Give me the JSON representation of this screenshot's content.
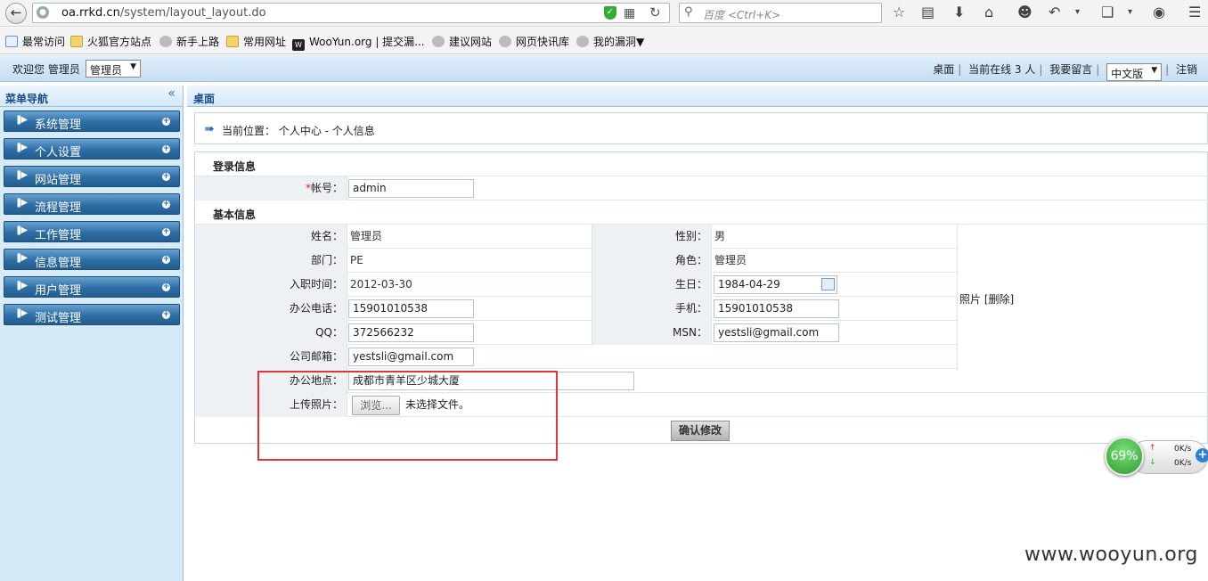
{
  "browser": {
    "url_domain": "oa.rrkd.cn",
    "url_path": "/system/layout_layout.do",
    "search_placeholder": "百度 <Ctrl+K>",
    "icons": [
      "back-icon",
      "globe-icon",
      "shield-icon",
      "qr-icon",
      "reload-icon",
      "search-icon",
      "star-icon",
      "reading-list-icon",
      "download-icon",
      "home-icon",
      "chat-icon",
      "undo-icon",
      "crop-icon",
      "comment-icon",
      "menu-icon"
    ]
  },
  "bookmarks": [
    {
      "label": "最常访问",
      "icon": "search-page-icon"
    },
    {
      "label": "火狐官方站点",
      "icon": "folder-icon"
    },
    {
      "label": "新手上路",
      "icon": "globe-icon"
    },
    {
      "label": "常用网址",
      "icon": "folder-icon"
    },
    {
      "label": "WooYun.org | 提交漏...",
      "icon": "wooyun-icon"
    },
    {
      "label": "建议网站",
      "icon": "globe-icon"
    },
    {
      "label": "网页快讯库",
      "icon": "globe-icon"
    },
    {
      "label": "我的漏洞▼",
      "icon": "globe-icon"
    }
  ],
  "header": {
    "welcome": "欢迎您 管理员",
    "role": "管理员",
    "desktop": "桌面",
    "online": "当前在线 3 人",
    "message": "我要留言",
    "lang": "中文版",
    "logout": "注销"
  },
  "sidebar": {
    "title": "菜单导航",
    "items": [
      "系统管理",
      "个人设置",
      "网站管理",
      "流程管理",
      "工作管理",
      "信息管理",
      "用户管理",
      "测试管理"
    ]
  },
  "main": {
    "tab_title": "桌面",
    "breadcrumb": "当前位置： 个人中心 - 个人信息",
    "login_section": "登录信息",
    "basic_section": "基本信息",
    "account_label": "帐号：",
    "account_value": "admin",
    "name_label": "姓名：",
    "name_value": "管理员",
    "gender_label": "性别：",
    "gender_value": "男",
    "dept_label": "部门：",
    "dept_value": "PE",
    "role_label": "角色：",
    "role_value": "管理员",
    "join_label": "入职时间：",
    "join_value": "2012-03-30",
    "birthday_label": "生日：",
    "birthday_value": "1984-04-29",
    "office_phone_label": "办公电话：",
    "office_phone_value": "15901010538",
    "mobile_label": "手机：",
    "mobile_value": "15901010538",
    "qq_label": "QQ：",
    "qq_value": "372566232",
    "msn_label": "MSN：",
    "msn_value": "yestsli@gmail.com",
    "email_label": "公司邮箱：",
    "email_value": "yestsli@gmail.com",
    "address_label": "办公地点：",
    "address_value": "成都市青羊区少城大厦",
    "upload_label": "上传照片：",
    "browse_label": "浏览...",
    "no_file": "未选择文件。",
    "photo_label": "照片 [删除]",
    "submit_label": "确认修改"
  },
  "net_widget": {
    "percent": "69%",
    "up": "0K/s",
    "down": "0K/s"
  },
  "watermark": "www.wooyun.org",
  "colors": {
    "highlight": "#e23535",
    "menu_blue": "#2d6ea6",
    "header_blue": "#c5dff4"
  }
}
